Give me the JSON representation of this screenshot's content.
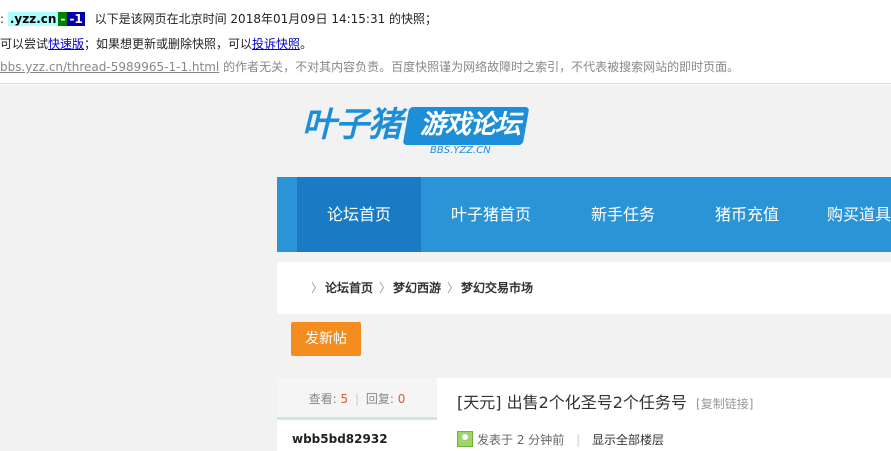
{
  "snapshot": {
    "line1": {
      "lead": ":",
      "hl1": ".yzz.cn",
      "hl2": "-",
      "hl3": "-1",
      "text": "以下是该网页在北京时间 2018年01月09日 14:15:31 的快照；"
    },
    "line2": {
      "pre": "可以尝试",
      "fast_link": "快速版",
      "mid": "；如果想更新或删除快照，可以",
      "complain_link": "投诉快照",
      "post": "。"
    },
    "line3": {
      "url": "bbs.yzz.cn/thread-5989965-1-1.html",
      "text": "的作者无关，不对其内容负责。百度快照谨为网络故障时之索引，不代表被搜索网站的即时页面。"
    }
  },
  "logo": {
    "main": "叶子猪",
    "badge": "游戏论坛",
    "sub": "BBS.YZZ.CN"
  },
  "nav": {
    "items": [
      {
        "label": "论坛首页"
      },
      {
        "label": "叶子猪首页"
      },
      {
        "label": "新手任务"
      },
      {
        "label": "猪币充值"
      },
      {
        "label": "购买道具"
      }
    ]
  },
  "breadcrumb": {
    "items": [
      "论坛首页",
      "梦幻西游",
      "梦幻交易市场"
    ]
  },
  "post_button": "发新帖",
  "thread": {
    "views_label": "查看:",
    "views": "5",
    "replies_label": "回复:",
    "replies": "0",
    "author": "wbb5bd82932",
    "title": "[天元] 出售2个化圣号2个任务号",
    "copy_link": "[复制链接]",
    "posted_prefix": "发表于",
    "posted_time": "2 分钟前",
    "show_all": "显示全部楼层"
  },
  "colors": {
    "nav_bg": "#2b94d6",
    "nav_active": "#1a7bc4",
    "post_button": "#f58d1e",
    "logo_blue": "#1d8ed8"
  }
}
